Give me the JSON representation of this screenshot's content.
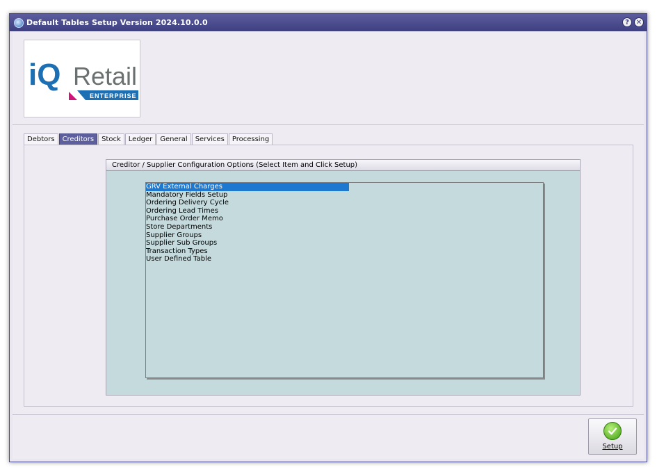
{
  "window": {
    "title": "Default Tables Setup Version 2024.10.0.0",
    "help_glyph": "?",
    "close_glyph": "✕"
  },
  "logo": {
    "brand_i": "iQ",
    "brand_word": "Retail",
    "tagline": "ENTERPRISE"
  },
  "tabs": [
    {
      "label": "Debtors",
      "active": false
    },
    {
      "label": "Creditors",
      "active": true
    },
    {
      "label": "Stock",
      "active": false
    },
    {
      "label": "Ledger",
      "active": false
    },
    {
      "label": "General",
      "active": false
    },
    {
      "label": "Services",
      "active": false
    },
    {
      "label": "Processing",
      "active": false
    }
  ],
  "config_group": {
    "title": "Creditor / Supplier Configuration Options (Select Item and Click Setup)",
    "items": [
      "GRV External Charges",
      "Mandatory Fields Setup",
      "Ordering Delivery Cycle",
      "Ordering Lead Times",
      "Purchase Order Memo",
      "Store Departments",
      "Supplier Groups",
      "Supplier Sub Groups",
      "Transaction Types",
      "User Defined Table"
    ],
    "selected_index": 0
  },
  "actions": {
    "setup_label": "Setup"
  },
  "colors": {
    "titlebar": "#3d3f80",
    "selection": "#1e78d0",
    "panel": "#c5dadd",
    "active_tab": "#5c5e9e"
  }
}
